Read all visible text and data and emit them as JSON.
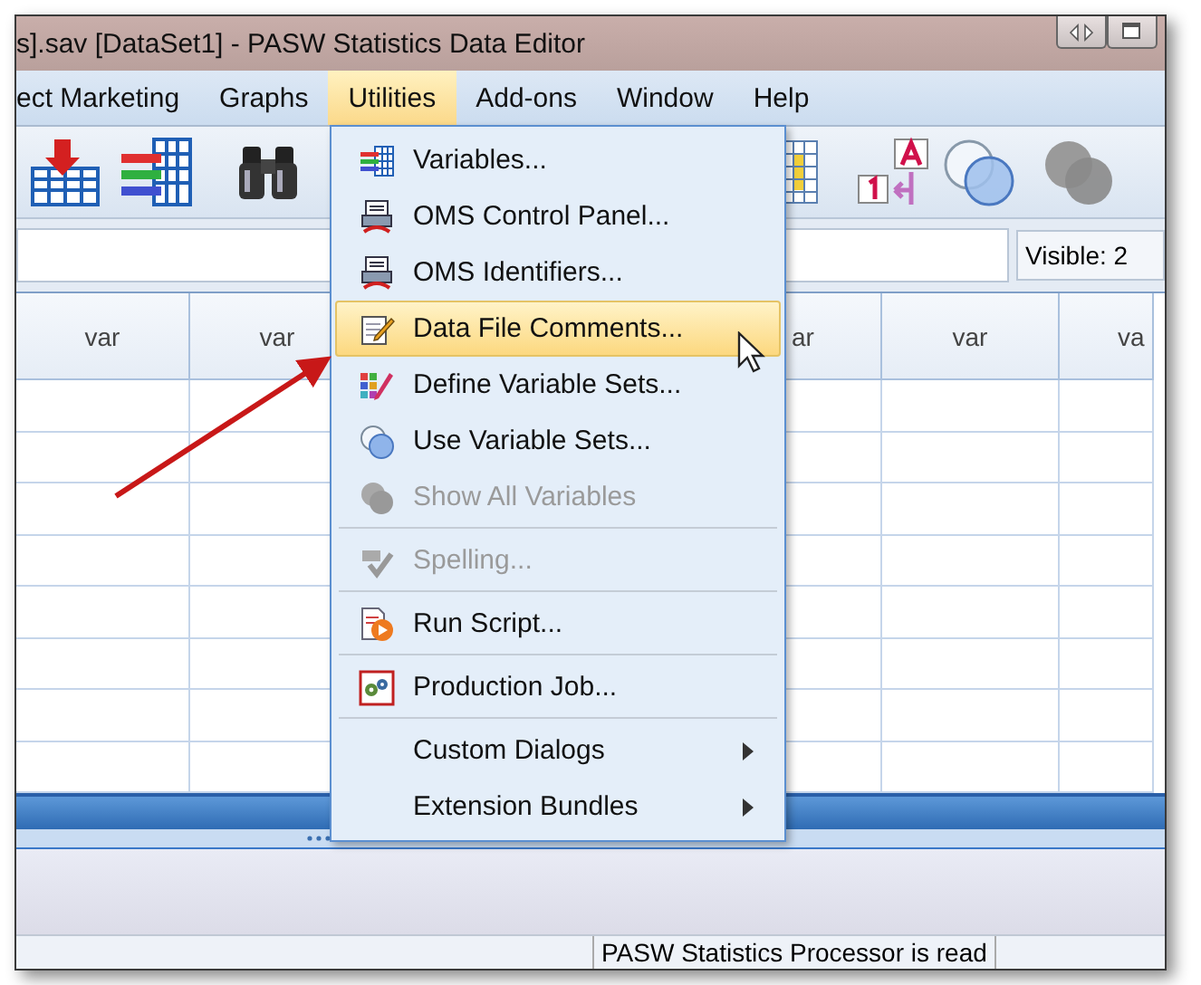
{
  "window": {
    "title": "s].sav [DataSet1] - PASW Statistics Data Editor"
  },
  "menubar": [
    {
      "label": "ect Marketing",
      "selected": false
    },
    {
      "label": "Graphs",
      "selected": false
    },
    {
      "label": "Utilities",
      "selected": true
    },
    {
      "label": "Add-ons",
      "selected": false
    },
    {
      "label": "Window",
      "selected": false
    },
    {
      "label": "Help",
      "selected": false
    }
  ],
  "info": {
    "visible": "Visible: 2"
  },
  "columns": [
    "var",
    "var",
    null,
    null,
    "ar",
    "var",
    "va"
  ],
  "menu": {
    "sections": [
      [
        {
          "label": "Variables...",
          "selected": false,
          "disabled": false,
          "submenu": false
        },
        {
          "label": "OMS Control Panel...",
          "selected": false,
          "disabled": false,
          "submenu": false
        },
        {
          "label": "OMS Identifiers...",
          "selected": false,
          "disabled": false,
          "submenu": false
        },
        {
          "label": "Data File Comments...",
          "selected": true,
          "disabled": false,
          "submenu": false
        },
        {
          "label": "Define Variable Sets...",
          "selected": false,
          "disabled": false,
          "submenu": false
        },
        {
          "label": "Use Variable Sets...",
          "selected": false,
          "disabled": false,
          "submenu": false
        },
        {
          "label": "Show All Variables",
          "selected": false,
          "disabled": true,
          "submenu": false
        }
      ],
      [
        {
          "label": "Spelling...",
          "selected": false,
          "disabled": true,
          "submenu": false
        }
      ],
      [
        {
          "label": "Run Script...",
          "selected": false,
          "disabled": false,
          "submenu": false
        }
      ],
      [
        {
          "label": "Production Job...",
          "selected": false,
          "disabled": false,
          "submenu": false
        }
      ],
      [
        {
          "label": "Custom Dialogs",
          "selected": false,
          "disabled": false,
          "submenu": true
        },
        {
          "label": "Extension Bundles",
          "selected": false,
          "disabled": false,
          "submenu": true
        }
      ]
    ]
  },
  "status_bar": {
    "message": "PASW Statistics Processor is read"
  }
}
